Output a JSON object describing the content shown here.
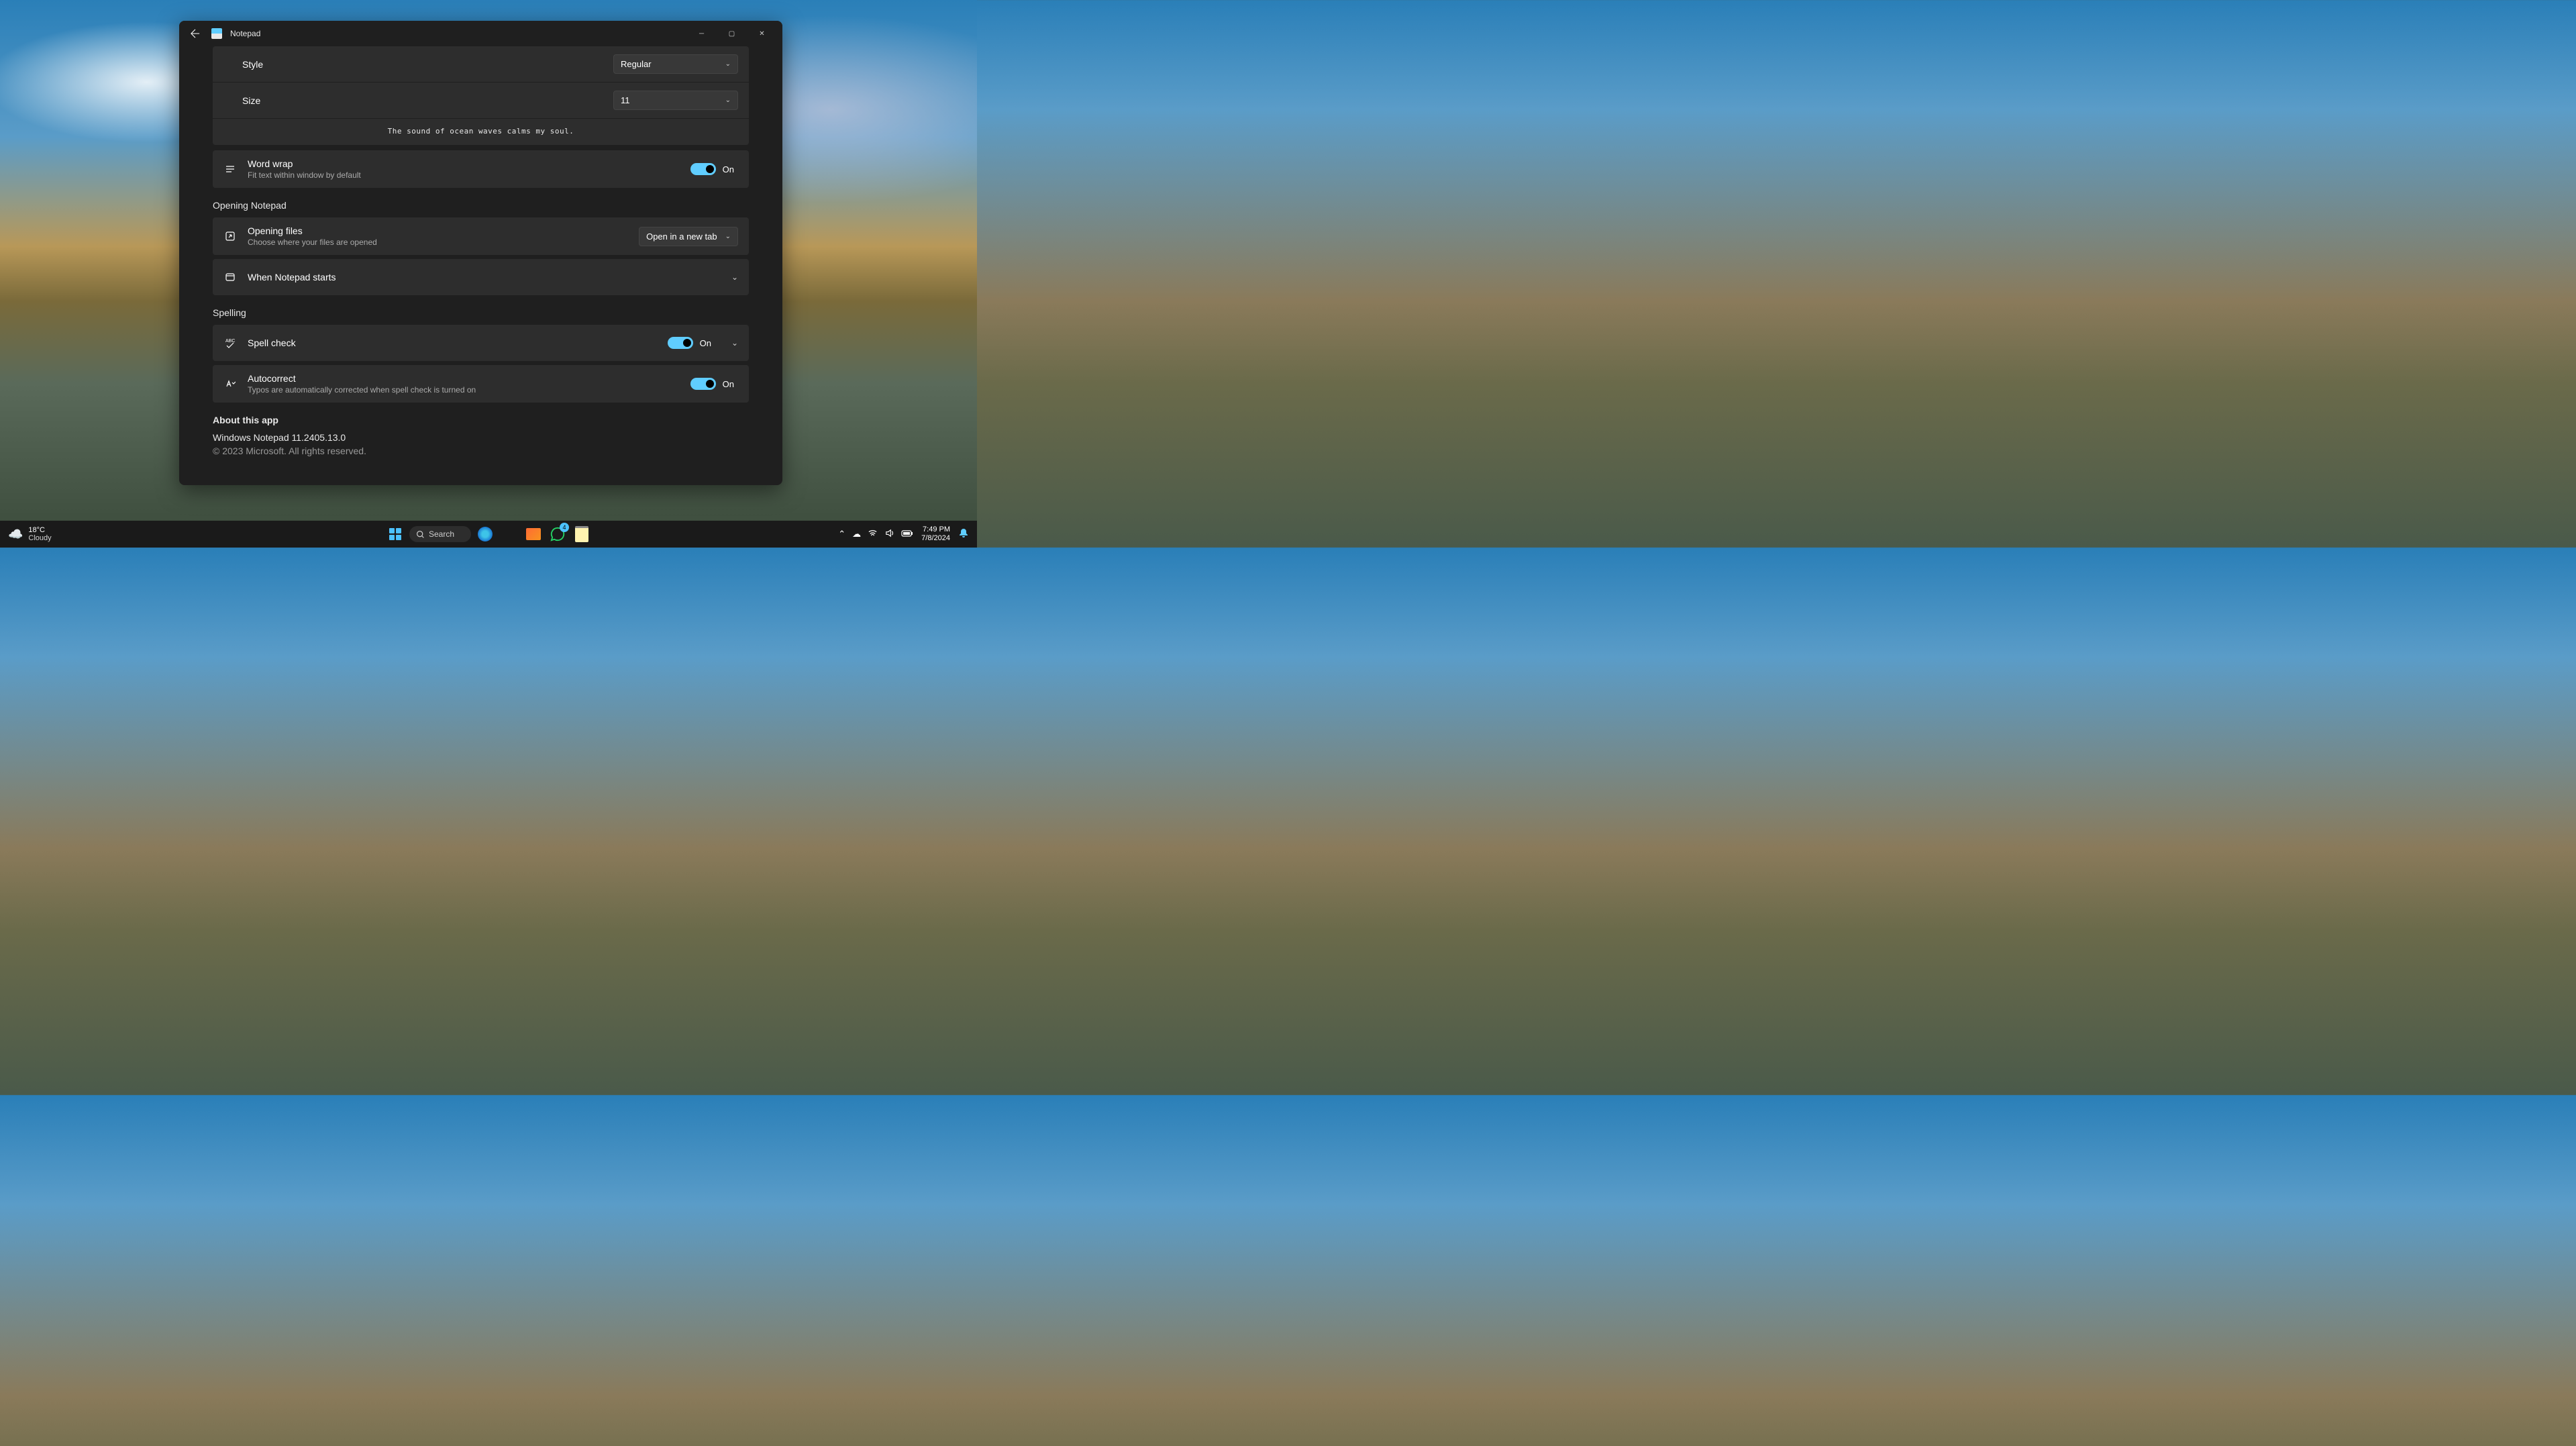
{
  "window": {
    "title": "Notepad"
  },
  "font": {
    "style_label": "Style",
    "style_value": "Regular",
    "size_label": "Size",
    "size_value": "11",
    "preview": "The sound of ocean waves calms my soul."
  },
  "wordwrap": {
    "title": "Word wrap",
    "desc": "Fit text within window by default",
    "state": "On"
  },
  "sections": {
    "opening": "Opening Notepad",
    "spelling": "Spelling",
    "about": "About this app"
  },
  "openingFiles": {
    "title": "Opening files",
    "desc": "Choose where your files are opened",
    "value": "Open in a new tab"
  },
  "whenStarts": {
    "title": "When Notepad starts"
  },
  "spellcheck": {
    "title": "Spell check",
    "state": "On"
  },
  "autocorrect": {
    "title": "Autocorrect",
    "desc": "Typos are automatically corrected when spell check is turned on",
    "state": "On"
  },
  "about": {
    "version": "Windows Notepad 11.2405.13.0",
    "copyright": "© 2023 Microsoft. All rights reserved."
  },
  "taskbar": {
    "weather_temp": "18°C",
    "weather_cond": "Cloudy",
    "search": "Search",
    "whatsapp_badge": "4",
    "time": "7:49 PM",
    "date": "7/8/2024"
  }
}
